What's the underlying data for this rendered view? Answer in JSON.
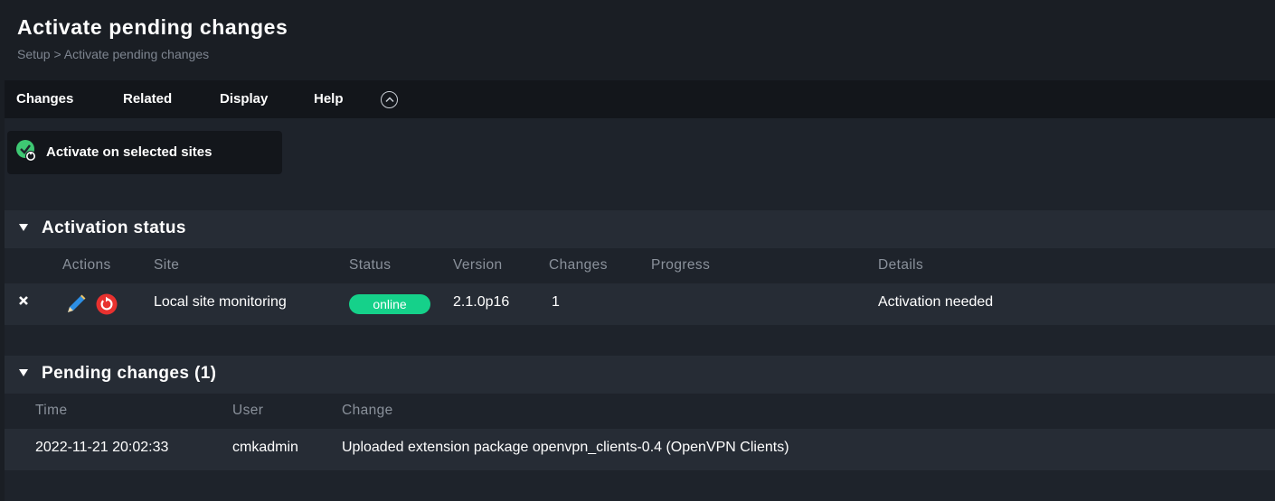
{
  "title": "Activate pending changes",
  "breadcrumb": "Setup > Activate pending changes",
  "menu": {
    "items": [
      "Changes",
      "Related",
      "Display",
      "Help"
    ]
  },
  "toolbar": {
    "activate_label": "Activate on selected sites"
  },
  "activation_status": {
    "title": "Activation status",
    "columns": [
      "Actions",
      "Site",
      "Status",
      "Version",
      "Changes",
      "Progress",
      "Details"
    ],
    "rows": [
      {
        "site": "Local site monitoring",
        "status": "online",
        "version": "2.1.0p16",
        "changes": "1",
        "progress": "",
        "details": "Activation needed"
      }
    ]
  },
  "pending_changes": {
    "title": "Pending changes (1)",
    "columns": [
      "Time",
      "User",
      "Change"
    ],
    "rows": [
      {
        "time": "2022-11-21 20:02:33",
        "user": "cmkadmin",
        "change": "Uploaded extension package openvpn_clients-0.4 (OpenVPN Clients)"
      }
    ]
  },
  "colors": {
    "background": "#1e232b",
    "header": "#1a1e24",
    "menubar": "#13161b",
    "section": "#262c35",
    "status_online": "#15d18a",
    "restart_red": "#e8312f",
    "check_green": "#3ec873",
    "pencil_blue": "#2d8fe6"
  },
  "icons": [
    "check-activate-icon",
    "collapse-chevron-icon",
    "section-toggle-icon",
    "remove-x-icon",
    "pencil-icon",
    "restart-icon"
  ]
}
